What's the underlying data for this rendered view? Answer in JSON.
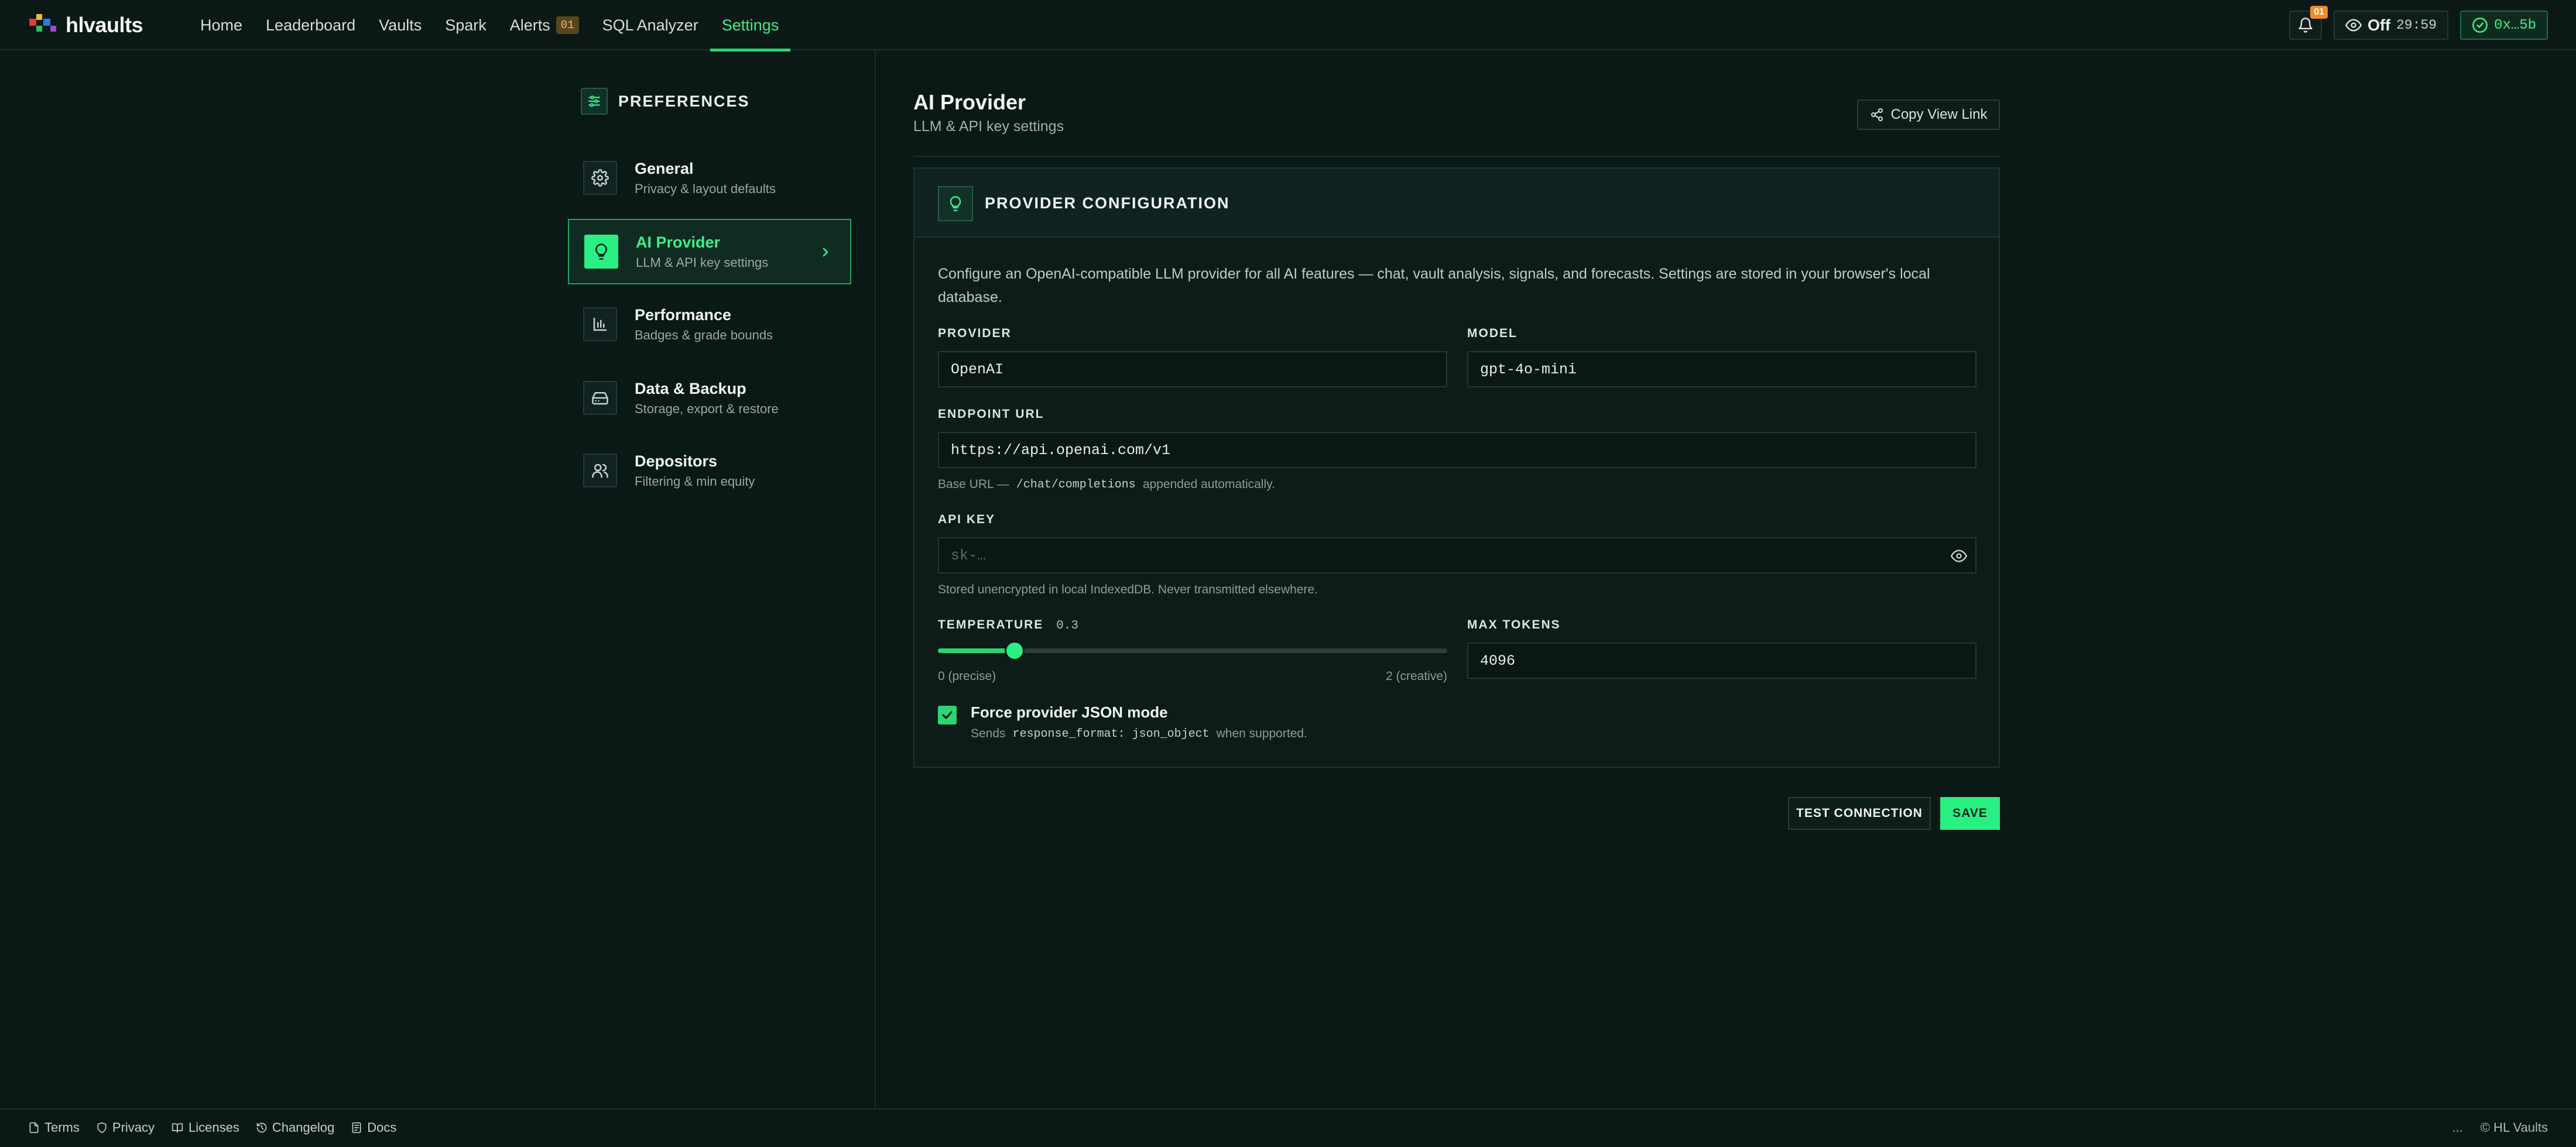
{
  "app": {
    "name": "hlvaults"
  },
  "nav": {
    "links": [
      {
        "label": "Home"
      },
      {
        "label": "Leaderboard"
      },
      {
        "label": "Vaults"
      },
      {
        "label": "Spark"
      },
      {
        "label": "Alerts",
        "badge": "01"
      },
      {
        "label": "SQL Analyzer"
      },
      {
        "label": "Settings",
        "active": true
      }
    ],
    "notifications_badge": "01",
    "watch_mode": {
      "label": "Off",
      "timer": "29:59"
    },
    "wallet": {
      "address": "0x…5b"
    }
  },
  "sidebar": {
    "title": "PREFERENCES",
    "items": [
      {
        "label": "General",
        "sub": "Privacy & layout defaults",
        "icon": "gear-icon"
      },
      {
        "label": "AI Provider",
        "sub": "LLM & API key settings",
        "icon": "lightbulb-icon",
        "active": true
      },
      {
        "label": "Performance",
        "sub": "Badges & grade bounds",
        "icon": "bar-chart-icon"
      },
      {
        "label": "Data & Backup",
        "sub": "Storage, export & restore",
        "icon": "drive-icon"
      },
      {
        "label": "Depositors",
        "sub": "Filtering & min equity",
        "icon": "users-icon"
      }
    ]
  },
  "main": {
    "title": "AI Provider",
    "subtitle": "LLM & API key settings",
    "copy_link_label": "Copy View Link",
    "card": {
      "title": "PROVIDER CONFIGURATION",
      "description": "Configure an OpenAI-compatible LLM provider for all AI features — chat, vault analysis, signals, and forecasts. Settings are stored in your browser's local database.",
      "provider": {
        "label": "PROVIDER",
        "value": "OpenAI"
      },
      "model": {
        "label": "MODEL",
        "value": "gpt-4o-mini"
      },
      "endpoint": {
        "label": "ENDPOINT URL",
        "value": "https://api.openai.com/v1",
        "hint_prefix": "Base URL —",
        "hint_code": "/chat/completions",
        "hint_suffix": "appended automatically."
      },
      "api_key": {
        "label": "API KEY",
        "placeholder": "sk-…",
        "hint": "Stored unencrypted in local IndexedDB. Never transmitted elsewhere."
      },
      "temperature": {
        "label": "TEMPERATURE",
        "value": "0.3",
        "min": 0,
        "max": 2,
        "current": 0.3,
        "min_label": "0 (precise)",
        "max_label": "2 (creative)"
      },
      "max_tokens": {
        "label": "MAX TOKENS",
        "value": "4096"
      },
      "json_mode": {
        "label": "Force provider JSON mode",
        "checked": true,
        "hint_prefix": "Sends",
        "hint_code": "response_format: json_object",
        "hint_suffix": "when supported."
      }
    },
    "buttons": {
      "test": "TEST CONNECTION",
      "save": "SAVE"
    }
  },
  "footer": {
    "links": [
      {
        "label": "Terms",
        "icon": "file-icon"
      },
      {
        "label": "Privacy",
        "icon": "shield-icon"
      },
      {
        "label": "Licenses",
        "icon": "book-icon"
      },
      {
        "label": "Changelog",
        "icon": "history-icon"
      },
      {
        "label": "Docs",
        "icon": "doc-icon"
      }
    ],
    "ellipsis": "...",
    "copyright": "© HL Vaults"
  },
  "colors": {
    "accent": "#2af083",
    "background": "#0a1816",
    "warning": "#ef8b2c"
  }
}
